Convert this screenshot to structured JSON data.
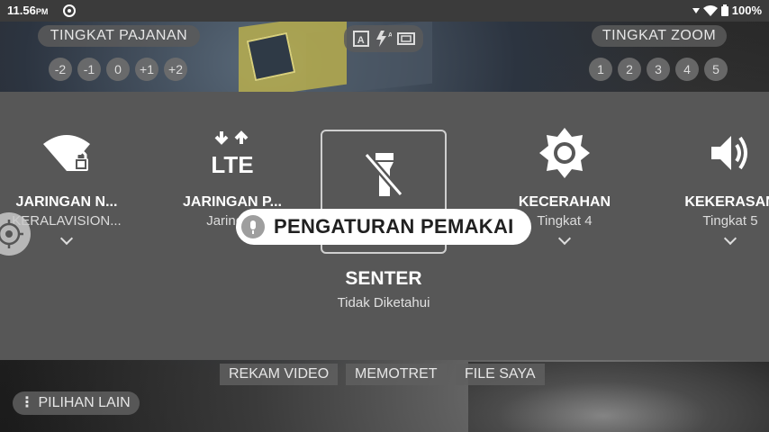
{
  "status_bar": {
    "time": "11.56",
    "ampm": "PM",
    "battery": "100%"
  },
  "camera": {
    "exposure_title": "TINGKAT PAJANAN",
    "exposure_levels": [
      "-2",
      "-1",
      "0",
      "+1",
      "+2"
    ],
    "zoom_title": "TINGKAT ZOOM",
    "zoom_levels": [
      "1",
      "2",
      "3",
      "4",
      "5"
    ],
    "modes": [
      "REKAM VIDEO",
      "MEMOTRET",
      "FILE SAYA"
    ],
    "more_options": "PILIHAN LAIN"
  },
  "quick_settings": {
    "tiles": [
      {
        "label": "JARINGAN N...",
        "sub": "KERALAVISION...",
        "icon": "wifi-lock-icon"
      },
      {
        "label": "JARINGAN P...",
        "sub": "Jaringan",
        "icon": "lte-icon"
      },
      {
        "label": "SENTER",
        "sub": "Tidak Diketahui",
        "icon": "flashlight-off-icon"
      },
      {
        "label": "KECERAHAN",
        "sub": "Tingkat 4",
        "icon": "brightness-icon"
      },
      {
        "label": "KEKERASAN",
        "sub": "Tingkat 5",
        "icon": "volume-icon"
      }
    ]
  },
  "voice_hint": {
    "text": "PENGATURAN PEMAKAI"
  }
}
